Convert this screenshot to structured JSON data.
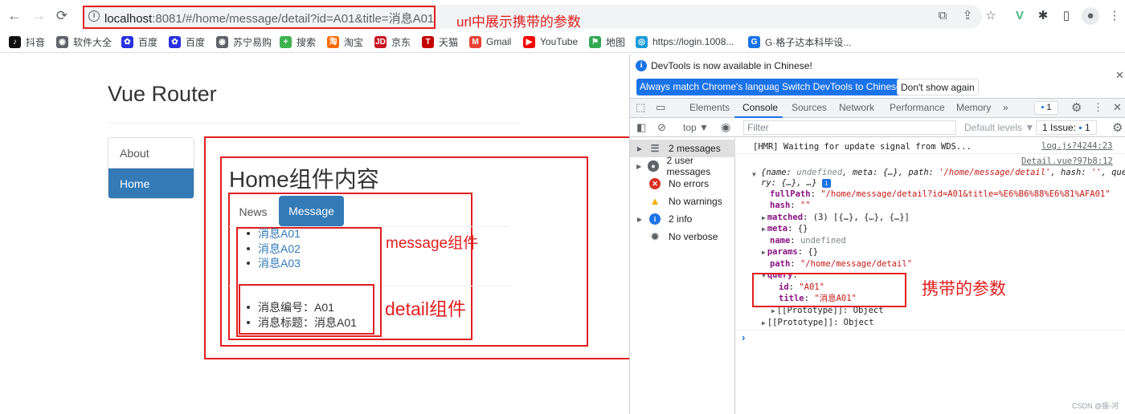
{
  "browser": {
    "nav": {
      "back": "←",
      "forward": "→",
      "reload": "⟳"
    },
    "url": {
      "host": "localhost",
      "rest": ":8081/#/home/message/detail?id=A01&title=消息A01"
    },
    "url_annotation": "url中展示携带的参数",
    "toolbar_icons": [
      "translate-icon",
      "share-icon",
      "star-icon",
      "vue-devtools-icon",
      "extensions-icon",
      "sidepanel-icon",
      "profile-icon",
      "menu-icon"
    ],
    "bookmarks": [
      {
        "label": "抖音",
        "icon": "tiktok-icon",
        "color": "#111111",
        "glyph": "♪"
      },
      {
        "label": "软件大全",
        "icon": "globe-icon",
        "color": "#5f6368",
        "glyph": "◉"
      },
      {
        "label": "百度",
        "icon": "baidu-icon",
        "color": "#2932e1",
        "glyph": "✿"
      },
      {
        "label": "百度",
        "icon": "baidu-icon",
        "color": "#2932e1",
        "glyph": "✿"
      },
      {
        "label": "苏宁易购",
        "icon": "globe-icon",
        "color": "#5f6368",
        "glyph": "◉"
      },
      {
        "label": "搜索",
        "icon": "search-360-icon",
        "color": "#3fb34f",
        "glyph": "+"
      },
      {
        "label": "淘宝",
        "icon": "taobao-icon",
        "color": "#ff6a00",
        "glyph": "淘"
      },
      {
        "label": "京东",
        "icon": "jd-icon",
        "color": "#c91623",
        "glyph": "JD"
      },
      {
        "label": "天猫",
        "icon": "tmall-icon",
        "color": "#c40000",
        "glyph": "T"
      },
      {
        "label": "Gmail",
        "icon": "gmail-icon",
        "color": "#ea4335",
        "glyph": "M"
      },
      {
        "label": "YouTube",
        "icon": "youtube-icon",
        "color": "#ff0000",
        "glyph": "▶"
      },
      {
        "label": "地图",
        "icon": "maps-icon",
        "color": "#34a853",
        "glyph": "⚑"
      },
      {
        "label": "https://login.1008...",
        "icon": "chinamobile-icon",
        "color": "#1a9bd7",
        "glyph": "◎"
      },
      {
        "label": "G·格子达本科毕设...",
        "icon": "gezida-icon",
        "color": "#1a73e8",
        "glyph": "G"
      }
    ]
  },
  "page": {
    "title": "Vue Router",
    "side_nav": [
      {
        "label": "About",
        "active": false
      },
      {
        "label": "Home",
        "active": true
      }
    ],
    "home_title": "Home组件内容",
    "tabs": [
      {
        "label": "News",
        "active": false
      },
      {
        "label": "Message",
        "active": true
      }
    ],
    "messages": [
      "消息A01",
      "消息A02",
      "消息A03"
    ],
    "detail": [
      "消息编号：A01",
      "消息标题：消息A01"
    ],
    "annotations": {
      "message": "message组件",
      "detail": "detail组件"
    }
  },
  "devtools": {
    "banner": {
      "text": "DevTools is now available in Chinese!",
      "buttons": [
        "Always match Chrome's language",
        "Switch DevTools to Chinese",
        "Don't show again"
      ]
    },
    "tabs": [
      "Elements",
      "Console",
      "Sources",
      "Network",
      "Performance",
      "Memory"
    ],
    "active_tab": "Console",
    "more_tabs": "»",
    "issue_badge": "1",
    "context": "top ▼",
    "filter_placeholder": "Filter",
    "levels": "Default levels ▼",
    "issues_label": "1 Issue:",
    "issues_count": "1",
    "sidebar": [
      {
        "label": "2 messages",
        "icon": "list-icon",
        "expandable": true,
        "selected": true
      },
      {
        "label": "2 user messages",
        "icon": "user-icon",
        "expandable": true,
        "selected": false
      },
      {
        "label": "No errors",
        "icon": "error-icon",
        "expandable": false,
        "selected": false
      },
      {
        "label": "No warnings",
        "icon": "warning-icon",
        "expandable": false,
        "selected": false
      },
      {
        "label": "2 info",
        "icon": "info-icon",
        "expandable": true,
        "selected": false
      },
      {
        "label": "No verbose",
        "icon": "bug-icon",
        "expandable": false,
        "selected": false
      }
    ],
    "console": {
      "hmr_text": "[HMR] Waiting for update signal from WDS...",
      "hmr_source": "log.js?4244:23",
      "detail_source": "Detail.vue?97b8:12",
      "obj_summary_1": "{name: undefined, meta: {…}, path: '/home/message/detail', hash: '', que",
      "obj_summary_2": "ry: {…}, …}",
      "fullPath_key": "fullPath",
      "fullPath_val": "\"/home/message/detail?id=A01&title=%E6%B6%88%E6%81%AFA01\"",
      "hash_key": "hash",
      "hash_val": "\"\"",
      "matched_key": "matched",
      "matched_val": "(3) [{…}, {…}, {…}]",
      "meta_key": "meta",
      "meta_val": "{}",
      "name_key": "name",
      "name_val": "undefined",
      "params_key": "params",
      "params_val": "{}",
      "path_key": "path",
      "path_val": "\"/home/message/detail\"",
      "query_key": "query",
      "id_key": "id",
      "id_val": "\"A01\"",
      "title_key": "title",
      "title_val": "\"消息A01\"",
      "proto_inner": "[[Prototype]]: Object",
      "proto_outer": "[[Prototype]]: Object",
      "prompt": "›"
    },
    "annotation": "携带的参数"
  },
  "watermark": "CSDN @振-河"
}
